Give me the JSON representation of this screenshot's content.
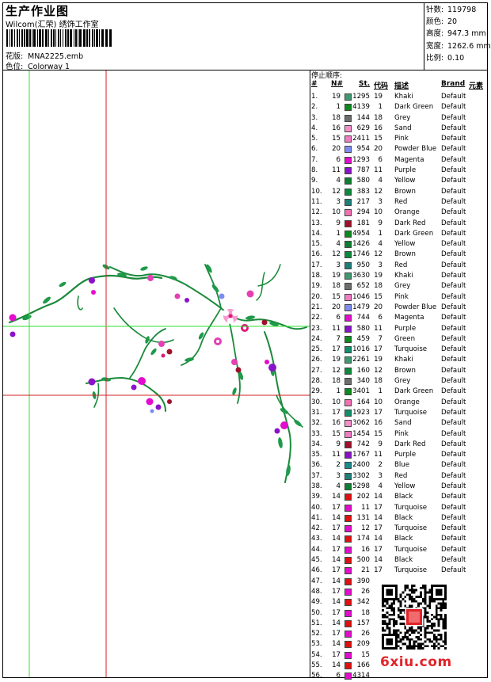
{
  "header": {
    "title": "生产作业图",
    "company": "Wilcom(汇荣) 绣饰工作室",
    "design_label": "花版:",
    "design_value": "MNA2225.emb",
    "colorway_label": "色位:",
    "colorway_value": "Colorway 1"
  },
  "stats": [
    {
      "label": "针数:",
      "value": "119798"
    },
    {
      "label": "颜色:",
      "value": "20"
    },
    {
      "label": "高度:",
      "value": "947.3 mm"
    },
    {
      "label": "宽度:",
      "value": "1262.6 mm"
    },
    {
      "label": "比例:",
      "value": "0.10"
    }
  ],
  "stops": {
    "title": "停止顺序:",
    "headers": {
      "num": "#",
      "needle": "N#",
      "st": "St.",
      "code": "代码",
      "desc": "描述",
      "brand": "Brand",
      "element": "元素"
    },
    "rows": [
      {
        "n": "1.",
        "nd": "19",
        "c": "#3f9a72",
        "st": "1295",
        "cd": "19",
        "ds": "Khaki",
        "br": "Default"
      },
      {
        "n": "2.",
        "nd": "1",
        "c": "#0b8a1e",
        "st": "4139",
        "cd": "1",
        "ds": "Dark Green",
        "br": "Default"
      },
      {
        "n": "3.",
        "nd": "18",
        "c": "#6d6d6d",
        "st": "144",
        "cd": "18",
        "ds": "Grey",
        "br": "Default"
      },
      {
        "n": "4.",
        "nd": "16",
        "c": "#f58fc9",
        "st": "629",
        "cd": "16",
        "ds": "Sand",
        "br": "Default"
      },
      {
        "n": "5.",
        "nd": "15",
        "c": "#f27bc5",
        "st": "2411",
        "cd": "15",
        "ds": "Pink",
        "br": "Default"
      },
      {
        "n": "6.",
        "nd": "20",
        "c": "#7d8cf2",
        "st": "954",
        "cd": "20",
        "ds": "Powder Blue",
        "br": "Default"
      },
      {
        "n": "7.",
        "nd": "6",
        "c": "#e40ccd",
        "st": "1293",
        "cd": "6",
        "ds": "Magenta",
        "br": "Default"
      },
      {
        "n": "8.",
        "nd": "11",
        "c": "#8a12c9",
        "st": "787",
        "cd": "11",
        "ds": "Purple",
        "br": "Default"
      },
      {
        "n": "9.",
        "nd": "4",
        "c": "#0b7f30",
        "st": "580",
        "cd": "4",
        "ds": "Yellow",
        "br": "Default"
      },
      {
        "n": "10.",
        "nd": "12",
        "c": "#0a8a3a",
        "st": "383",
        "cd": "12",
        "ds": "Brown",
        "br": "Default"
      },
      {
        "n": "11.",
        "nd": "3",
        "c": "#1d7f78",
        "st": "217",
        "cd": "3",
        "ds": "Red",
        "br": "Default"
      },
      {
        "n": "12.",
        "nd": "10",
        "c": "#f36fb3",
        "st": "294",
        "cd": "10",
        "ds": "Orange",
        "br": "Default"
      },
      {
        "n": "13.",
        "nd": "9",
        "c": "#a0102a",
        "st": "181",
        "cd": "9",
        "ds": "Dark Red",
        "br": "Default"
      },
      {
        "n": "14.",
        "nd": "1",
        "c": "#0b8a1e",
        "st": "4954",
        "cd": "1",
        "ds": "Dark Green",
        "br": "Default"
      },
      {
        "n": "15.",
        "nd": "4",
        "c": "#0b7f30",
        "st": "1426",
        "cd": "4",
        "ds": "Yellow",
        "br": "Default"
      },
      {
        "n": "16.",
        "nd": "12",
        "c": "#0a8a3a",
        "st": "1746",
        "cd": "12",
        "ds": "Brown",
        "br": "Default"
      },
      {
        "n": "17.",
        "nd": "3",
        "c": "#1d7f78",
        "st": "950",
        "cd": "3",
        "ds": "Red",
        "br": "Default"
      },
      {
        "n": "18.",
        "nd": "19",
        "c": "#3f9a72",
        "st": "3630",
        "cd": "19",
        "ds": "Khaki",
        "br": "Default"
      },
      {
        "n": "19.",
        "nd": "18",
        "c": "#6d6d6d",
        "st": "652",
        "cd": "18",
        "ds": "Grey",
        "br": "Default"
      },
      {
        "n": "20.",
        "nd": "15",
        "c": "#f27bc5",
        "st": "1046",
        "cd": "15",
        "ds": "Pink",
        "br": "Default"
      },
      {
        "n": "21.",
        "nd": "20",
        "c": "#7d8cf2",
        "st": "1479",
        "cd": "20",
        "ds": "Powder Blue",
        "br": "Default"
      },
      {
        "n": "22.",
        "nd": "6",
        "c": "#e40ccd",
        "st": "744",
        "cd": "6",
        "ds": "Magenta",
        "br": "Default"
      },
      {
        "n": "23.",
        "nd": "11",
        "c": "#8a12c9",
        "st": "580",
        "cd": "11",
        "ds": "Purple",
        "br": "Default"
      },
      {
        "n": "24.",
        "nd": "7",
        "c": "#0b8a1e",
        "st": "459",
        "cd": "7",
        "ds": "Green",
        "br": "Default"
      },
      {
        "n": "25.",
        "nd": "17",
        "c": "#0f8f6a",
        "st": "1016",
        "cd": "17",
        "ds": "Turquoise",
        "br": "Default"
      },
      {
        "n": "26.",
        "nd": "19",
        "c": "#3f9a72",
        "st": "2261",
        "cd": "19",
        "ds": "Khaki",
        "br": "Default"
      },
      {
        "n": "27.",
        "nd": "12",
        "c": "#0a8a3a",
        "st": "160",
        "cd": "12",
        "ds": "Brown",
        "br": "Default"
      },
      {
        "n": "28.",
        "nd": "18",
        "c": "#6d6d6d",
        "st": "340",
        "cd": "18",
        "ds": "Grey",
        "br": "Default"
      },
      {
        "n": "29.",
        "nd": "1",
        "c": "#0b8a1e",
        "st": "3401",
        "cd": "1",
        "ds": "Dark Green",
        "br": "Default"
      },
      {
        "n": "30.",
        "nd": "10",
        "c": "#f36fb3",
        "st": "164",
        "cd": "10",
        "ds": "Orange",
        "br": "Default"
      },
      {
        "n": "31.",
        "nd": "17",
        "c": "#0f8f6a",
        "st": "1923",
        "cd": "17",
        "ds": "Turquoise",
        "br": "Default"
      },
      {
        "n": "32.",
        "nd": "16",
        "c": "#f58fc9",
        "st": "3062",
        "cd": "16",
        "ds": "Sand",
        "br": "Default"
      },
      {
        "n": "33.",
        "nd": "15",
        "c": "#f27bc5",
        "st": "1454",
        "cd": "15",
        "ds": "Pink",
        "br": "Default"
      },
      {
        "n": "34.",
        "nd": "9",
        "c": "#a0102a",
        "st": "742",
        "cd": "9",
        "ds": "Dark Red",
        "br": "Default"
      },
      {
        "n": "35.",
        "nd": "11",
        "c": "#8a12c9",
        "st": "1767",
        "cd": "11",
        "ds": "Purple",
        "br": "Default"
      },
      {
        "n": "36.",
        "nd": "2",
        "c": "#1a8a8a",
        "st": "2400",
        "cd": "2",
        "ds": "Blue",
        "br": "Default"
      },
      {
        "n": "37.",
        "nd": "3",
        "c": "#1d7f78",
        "st": "3302",
        "cd": "3",
        "ds": "Red",
        "br": "Default"
      },
      {
        "n": "38.",
        "nd": "4",
        "c": "#0b7f30",
        "st": "5298",
        "cd": "4",
        "ds": "Yellow",
        "br": "Default"
      },
      {
        "n": "39.",
        "nd": "14",
        "c": "#e01010",
        "st": "202",
        "cd": "14",
        "ds": "Black",
        "br": "Default"
      },
      {
        "n": "40.",
        "nd": "17",
        "c": "#e40ccd",
        "st": "11",
        "cd": "17",
        "ds": "Turquoise",
        "br": "Default"
      },
      {
        "n": "41.",
        "nd": "14",
        "c": "#e01010",
        "st": "131",
        "cd": "14",
        "ds": "Black",
        "br": "Default"
      },
      {
        "n": "42.",
        "nd": "17",
        "c": "#e40ccd",
        "st": "12",
        "cd": "17",
        "ds": "Turquoise",
        "br": "Default"
      },
      {
        "n": "43.",
        "nd": "14",
        "c": "#e01010",
        "st": "174",
        "cd": "14",
        "ds": "Black",
        "br": "Default"
      },
      {
        "n": "44.",
        "nd": "17",
        "c": "#e40ccd",
        "st": "16",
        "cd": "17",
        "ds": "Turquoise",
        "br": "Default"
      },
      {
        "n": "45.",
        "nd": "14",
        "c": "#e01010",
        "st": "500",
        "cd": "14",
        "ds": "Black",
        "br": "Default"
      },
      {
        "n": "46.",
        "nd": "17",
        "c": "#e40ccd",
        "st": "21",
        "cd": "17",
        "ds": "Turquoise",
        "br": "Default"
      },
      {
        "n": "47.",
        "nd": "14",
        "c": "#e01010",
        "st": "390",
        "cd": "",
        "ds": "",
        "br": ""
      },
      {
        "n": "48.",
        "nd": "17",
        "c": "#e40ccd",
        "st": "26",
        "cd": "",
        "ds": "",
        "br": ""
      },
      {
        "n": "49.",
        "nd": "14",
        "c": "#e01010",
        "st": "342",
        "cd": "",
        "ds": "",
        "br": ""
      },
      {
        "n": "50.",
        "nd": "17",
        "c": "#e40ccd",
        "st": "18",
        "cd": "",
        "ds": "",
        "br": ""
      },
      {
        "n": "51.",
        "nd": "14",
        "c": "#e01010",
        "st": "157",
        "cd": "",
        "ds": "",
        "br": ""
      },
      {
        "n": "52.",
        "nd": "17",
        "c": "#e40ccd",
        "st": "26",
        "cd": "",
        "ds": "",
        "br": ""
      },
      {
        "n": "53.",
        "nd": "14",
        "c": "#e01010",
        "st": "209",
        "cd": "",
        "ds": "",
        "br": ""
      },
      {
        "n": "54.",
        "nd": "17",
        "c": "#e40ccd",
        "st": "15",
        "cd": "",
        "ds": "",
        "br": ""
      },
      {
        "n": "55.",
        "nd": "14",
        "c": "#e01010",
        "st": "166",
        "cd": "",
        "ds": "",
        "br": ""
      },
      {
        "n": "56.",
        "nd": "6",
        "c": "#e40ccd",
        "st": "4314",
        "cd": "",
        "ds": "",
        "br": ""
      }
    ]
  },
  "watermark": "6xiu.com",
  "colors": {
    "guide_green": "#2ee02e",
    "guide_red": "#d42020",
    "watermark_red": "#e0242a"
  }
}
